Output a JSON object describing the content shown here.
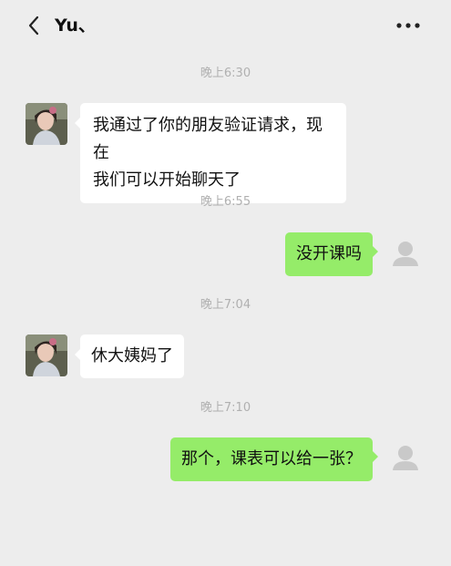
{
  "header": {
    "title": "Yu、",
    "back_icon": "chevron-left-icon",
    "more_icon": "more-dots-icon"
  },
  "messages": [
    {
      "type": "timestamp",
      "text": "晚上6:30"
    },
    {
      "type": "incoming",
      "text": "我通过了你的朋友验证请求，现在我们可以开始聊天了",
      "lines": [
        "我通过了你的朋友验证请求，现在",
        "我们可以开始聊天了"
      ]
    },
    {
      "type": "timestamp",
      "text": "晚上6:55"
    },
    {
      "type": "outgoing",
      "text": "没开课吗"
    },
    {
      "type": "timestamp",
      "text": "晚上7:04"
    },
    {
      "type": "incoming",
      "text": "休大姨妈了"
    },
    {
      "type": "timestamp",
      "text": "晚上7:10"
    },
    {
      "type": "outgoing",
      "text": "那个，课表可以给一张？"
    }
  ],
  "colors": {
    "background": "#ededed",
    "outgoing_bubble": "#95ec69",
    "incoming_bubble": "#ffffff",
    "timestamp_text": "#b0b0b0"
  }
}
